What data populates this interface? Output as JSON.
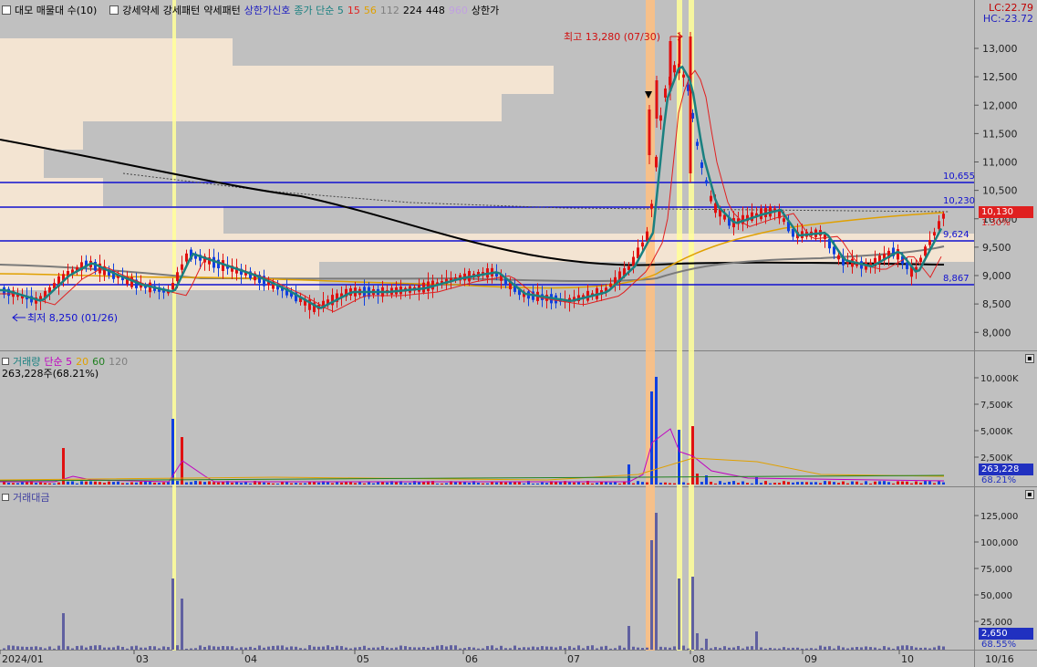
{
  "legend": {
    "checkbox_label": "대모 매물대 수(10)",
    "items": [
      {
        "label": "강세약세",
        "color": "#000000"
      },
      {
        "label": "강세패턴",
        "color": "#000000"
      },
      {
        "label": "약세패턴",
        "color": "#000000"
      },
      {
        "label": "상한가신호",
        "color": "#2020c0"
      },
      {
        "label": "종가 단순 5",
        "color": "#1a8080"
      },
      {
        "label": "15",
        "color": "#e02020"
      },
      {
        "label": "56",
        "color": "#e0a000"
      },
      {
        "label": "112",
        "color": "#808080"
      },
      {
        "label": "224",
        "color": "#000000"
      },
      {
        "label": "448",
        "color": "#000000"
      },
      {
        "label": "960",
        "color": "#c0a0e0"
      },
      {
        "label": "상한가",
        "color": "#000000"
      }
    ]
  },
  "corner": {
    "lc": "LC:22.79",
    "hc": "HC:-23.72"
  },
  "price_panel": {
    "y_ticks": [
      "13,000",
      "12,500",
      "12,000",
      "11,500",
      "11,000",
      "10,500",
      "10,000",
      "9,500",
      "9,000",
      "8,500",
      "8,000"
    ],
    "levels": [
      "10,655",
      "10,230",
      "9,624",
      "8,867"
    ],
    "high_label": "최고 13,280 (07/30)",
    "low_label": "최저 8,250 (01/26)",
    "current_price": "10,130",
    "current_change": "1.30%"
  },
  "volume_panel": {
    "legend_title": "거래량",
    "legend_items": [
      {
        "label": "단순 5",
        "color": "#c000c0"
      },
      {
        "label": "20",
        "color": "#e0a000"
      },
      {
        "label": "60",
        "color": "#208020"
      },
      {
        "label": "120",
        "color": "#808080"
      }
    ],
    "summary": "263,228주(68.21%)",
    "y_ticks": [
      "10,000K",
      "7,500K",
      "5,000K",
      "2,500K"
    ],
    "current_value": "263,228",
    "current_pct": "68.21%"
  },
  "amount_panel": {
    "legend_title": "거래대금",
    "y_ticks": [
      "125,000",
      "100,000",
      "75,000",
      "50,000",
      "25,000"
    ],
    "current_value": "2,650",
    "current_pct": "68.55%"
  },
  "x_axis": {
    "labels": [
      "2024/01",
      "03",
      "04",
      "05",
      "06",
      "07",
      "08",
      "09",
      "10"
    ],
    "end_label": "10/16"
  }
}
